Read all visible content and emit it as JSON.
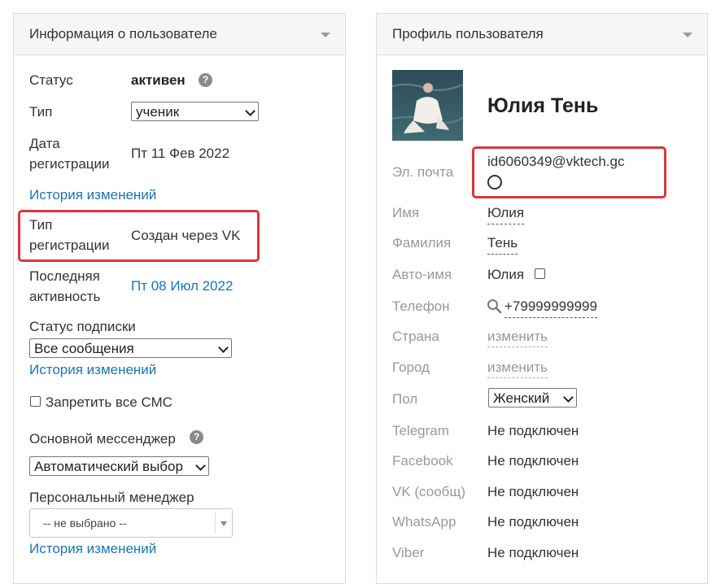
{
  "left_panel": {
    "title": "Информация о пользователе",
    "status_label": "Статус",
    "status_value": "активен",
    "help_glyph": "?",
    "type_label": "Тип",
    "type_value": "ученик",
    "reg_date_label_1": "Дата",
    "reg_date_label_2": "регистрации",
    "reg_date_value": "Пт 11 Фев 2022",
    "history_link": "История изменений",
    "reg_type_label_1": "Тип",
    "reg_type_label_2": "регистрации",
    "reg_type_value": "Создан через VK",
    "last_activity_label_1": "Последняя",
    "last_activity_label_2": "активность",
    "last_activity_value": "Пт 08 Июл 2022",
    "subscription_label": "Статус подписки",
    "subscription_value": "Все сообщения",
    "block_sms_label": "Запретить все СМС",
    "messenger_label": "Основной мессенджер",
    "messenger_value": "Автоматический выбор",
    "manager_label": "Персональный менеджер",
    "manager_value": "-- не выбрано --"
  },
  "right_panel": {
    "title": "Профиль пользователя",
    "name": "Юлия Тень",
    "email_label": "Эл. почта",
    "email_value": "id6060349@vktech.gc",
    "first_name_label": "Имя",
    "first_name_value": "Юлия",
    "last_name_label": "Фамилия",
    "last_name_value": "Тень",
    "auto_name_label": "Авто-имя",
    "auto_name_value": "Юлия",
    "phone_label": "Телефон",
    "phone_value": "+79999999999",
    "country_label": "Страна",
    "city_label": "Город",
    "change_link": "изменить",
    "gender_label": "Пол",
    "gender_value": "Женский",
    "telegram_label": "Telegram",
    "facebook_label": "Facebook",
    "vk_label": "VK (сообщ)",
    "whatsapp_label": "WhatsApp",
    "viber_label": "Viber",
    "not_connected": "Не подключен"
  },
  "colors": {
    "link": "#1a73b5",
    "highlight": "#d9363e",
    "muted": "#999999"
  }
}
